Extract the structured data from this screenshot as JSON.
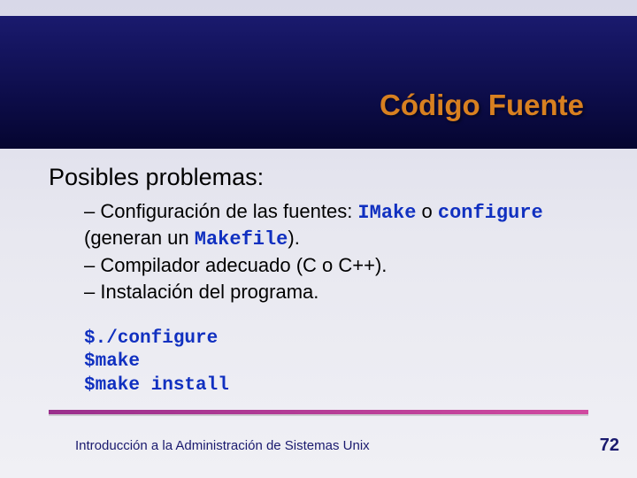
{
  "title": "Código Fuente",
  "subtitle": "Posibles problemas:",
  "bullets": {
    "b1_pre": "– Configuración de las fuentes: ",
    "b1_code1": "IMake",
    "b1_mid": " o ",
    "b1_code2": "configure",
    "b1_mid2": " (generan un ",
    "b1_code3": "Makefile",
    "b1_post": ").",
    "b2": "– Compilador adecuado (C o C++).",
    "b3": "– Instalación del programa."
  },
  "code": {
    "l1": "$./configure",
    "l2": "$make",
    "l3": "$make install"
  },
  "footer": "Introducción a la Administración de Sistemas Unix",
  "page": "72"
}
